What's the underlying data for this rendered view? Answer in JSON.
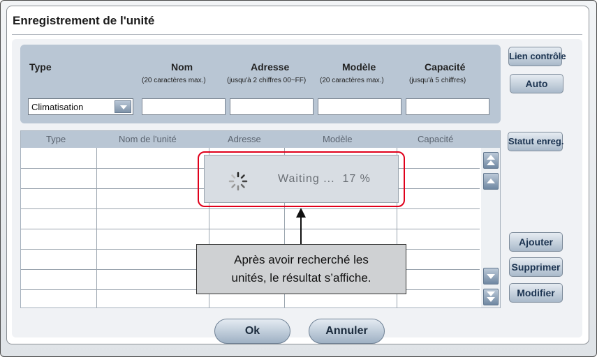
{
  "title": "Enregistrement de l'unité",
  "form": {
    "headers": [
      "Type",
      "Nom",
      "Adresse",
      "Modèle",
      "Capacité"
    ],
    "subs": {
      "nom": "(20 caractères max.)",
      "adresse": "(jusqu'à 2 chiffres 00~FF)",
      "modele": "(20 caractères max.)",
      "capacite": "(jusqu'à 5 chiffres)"
    },
    "type_value": "Climatisation",
    "nom_value": "",
    "adresse_value": "",
    "modele_value": "",
    "capacite_value": ""
  },
  "grid": {
    "columns": [
      "Type",
      "Nom de l'unité",
      "Adresse",
      "Modèle",
      "Capacité"
    ]
  },
  "buttons": {
    "lien_controle": "Lien contrôle",
    "auto": "Auto",
    "statut_enreg": "Statut enreg.",
    "ajouter": "Ajouter",
    "supprimer": "Supprimer",
    "modifier": "Modifier",
    "ok": "Ok",
    "annuler": "Annuler"
  },
  "waiting": {
    "label": "Waiting ...",
    "percent_text": "17 %",
    "progress": 0.17
  },
  "callout": {
    "line1": "Après avoir recherché les",
    "line2": "unités, le résultat s’affiche."
  },
  "colors": {
    "highlight": "#e0001b",
    "panel": "#b9c6d4",
    "button_text": "#1b3350"
  },
  "icons": {
    "spinner": "spinner-icon",
    "dropdown": "chevron-down-icon",
    "scroll_top": "double-chevron-up-icon",
    "scroll_up": "chevron-up-icon",
    "scroll_down": "chevron-down-icon",
    "scroll_bottom": "double-chevron-down-icon"
  }
}
